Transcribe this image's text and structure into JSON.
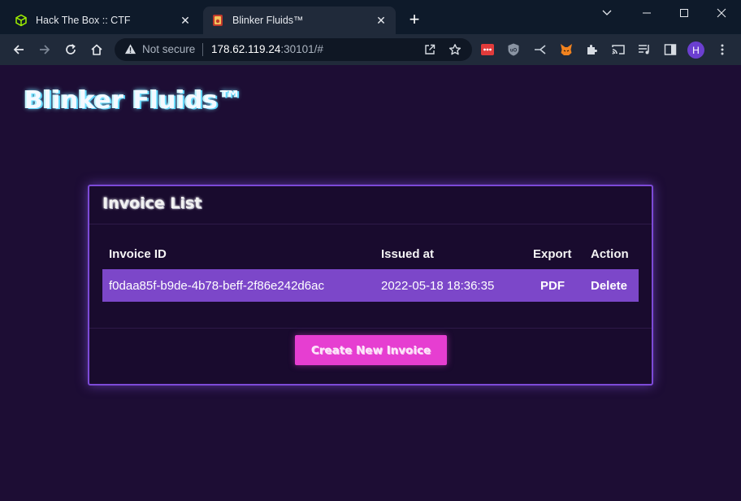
{
  "browser": {
    "tabs": [
      {
        "title": "Hack The Box :: CTF",
        "favicon": "cube-icon",
        "active": false
      },
      {
        "title": "Blinker Fluids™",
        "favicon": "site-icon",
        "active": true
      }
    ],
    "address": {
      "security_label": "Not secure",
      "host": "178.62.119.24",
      "rest": ":30101/#"
    },
    "profile_initial": "H"
  },
  "page": {
    "brand": "Blinker Fluids™",
    "card": {
      "title": "Invoice List",
      "columns": [
        "Invoice ID",
        "Issued at",
        "Export",
        "Action"
      ],
      "rows": [
        {
          "id": "f0daa85f-b9de-4b78-beff-2f86e242d6ac",
          "issued": "2022-05-18 18:36:35",
          "export": "PDF",
          "action": "Delete"
        }
      ],
      "create_button": "Create New Invoice"
    }
  },
  "colors": {
    "background": "#1d0d34",
    "card_border": "#7d4ad8",
    "row_highlight": "#7c47c9",
    "button": "#e63ed1"
  }
}
